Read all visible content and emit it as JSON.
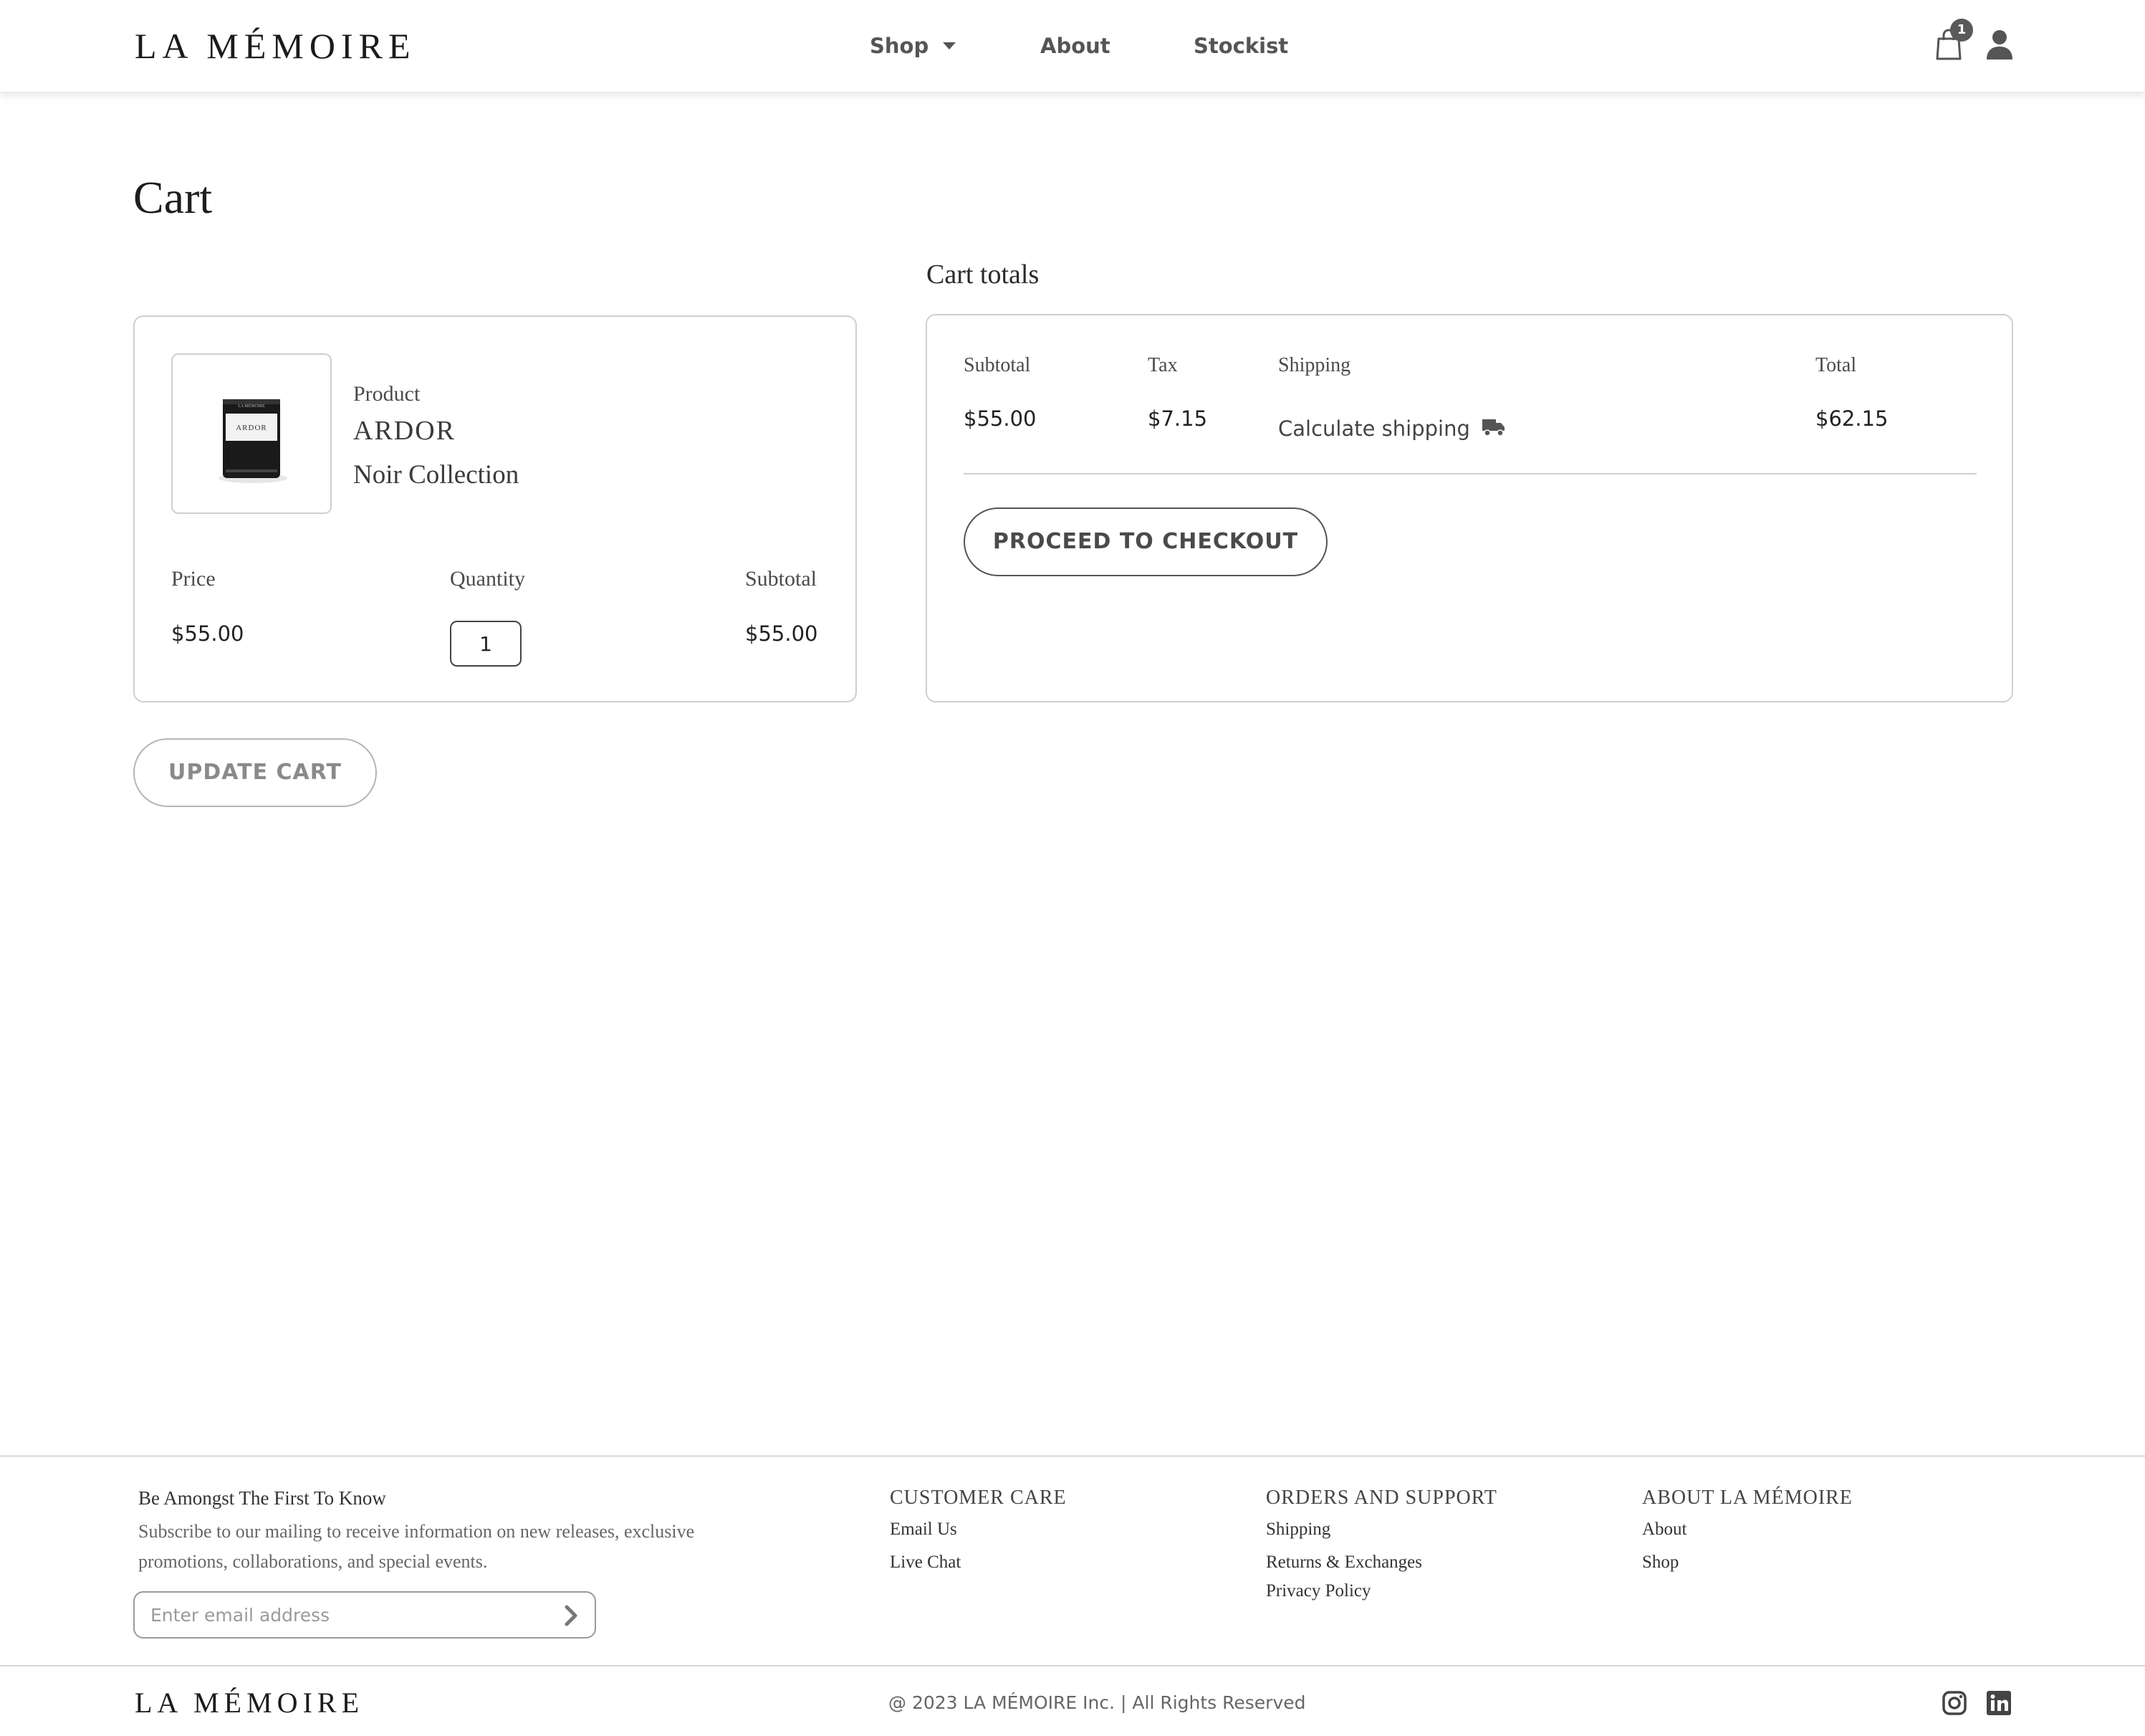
{
  "header": {
    "logo": "LA MÉMOIRE",
    "nav": {
      "shop": "Shop",
      "about": "About",
      "stockist": "Stockist"
    },
    "cart_count": "1"
  },
  "page": {
    "title": "Cart"
  },
  "cart_item": {
    "product_label": "Product",
    "name": "ARDOR",
    "collection": "Noir Collection",
    "thumb_brand": "LA MÉMOIRE",
    "thumb_name": "ARDOR",
    "price_label": "Price",
    "quantity_label": "Quantity",
    "subtotal_label": "Subtotal",
    "price": "$55.00",
    "quantity": "1",
    "subtotal": "$55.00"
  },
  "update_cart_label": "UPDATE CART",
  "totals": {
    "heading": "Cart totals",
    "subtotal_label": "Subtotal",
    "tax_label": "Tax",
    "shipping_label": "Shipping",
    "total_label": "Total",
    "subtotal": "$55.00",
    "tax": "$7.15",
    "calculate_shipping": "Calculate shipping",
    "total": "$62.15",
    "checkout_label": "PROCEED TO CHECKOUT"
  },
  "footer": {
    "newsletter": {
      "title": "Be Amongst The First To Know",
      "text": "Subscribe to our mailing to receive information on new releases, exclusive promotions, collaborations, and special events.",
      "placeholder": "Enter email address"
    },
    "customer_care": {
      "title": "CUSTOMER CARE",
      "email_us": "Email Us",
      "live_chat": "Live Chat"
    },
    "orders_support": {
      "title": "ORDERS AND SUPPORT",
      "shipping": "Shipping",
      "returns": "Returns & Exchanges",
      "privacy": "Privacy Policy"
    },
    "about": {
      "title": "ABOUT LA MÉMOIRE",
      "about": "About",
      "shop": "Shop"
    },
    "logo": "LA MÉMOIRE",
    "copyright": "@ 2023 LA MÉMOIRE Inc. | All Rights Reserved"
  },
  "icons": {
    "cart": "shopping-bag-icon",
    "account": "user-icon",
    "shipping": "truck-icon",
    "submit": "chevron-right-icon",
    "instagram": "instagram-icon",
    "linkedin": "linkedin-icon"
  },
  "colors": {
    "text": "#222222",
    "muted": "#666666",
    "border": "#cfcfcf",
    "badge": "#5a5a5a"
  }
}
